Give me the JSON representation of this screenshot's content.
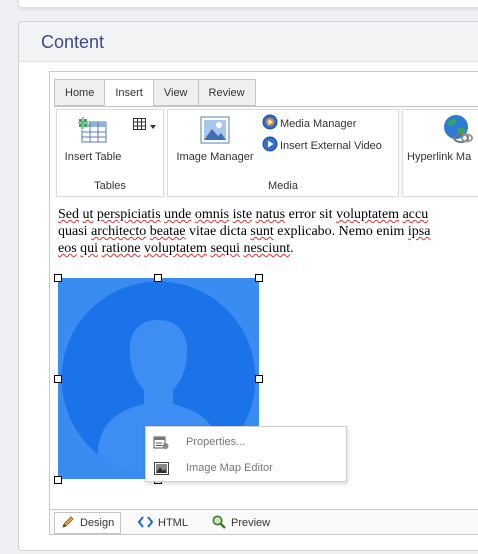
{
  "panel": {
    "title": "Content"
  },
  "tabs": [
    {
      "label": "Home",
      "active": false
    },
    {
      "label": "Insert",
      "active": true
    },
    {
      "label": "View",
      "active": false
    },
    {
      "label": "Review",
      "active": false
    }
  ],
  "ribbon": {
    "tables": {
      "group_label": "Tables",
      "insert_table_label": "Insert Table",
      "table_dropdown_icon": "table-grid-icon"
    },
    "media": {
      "group_label": "Media",
      "image_manager_label": "Image Manager",
      "media_manager_label": "Media Manager",
      "insert_video_label": "Insert External Video"
    },
    "links": {
      "hyperlink_label": "Hyperlink Ma"
    }
  },
  "content": {
    "line1": [
      "Sed",
      "ut",
      "perspiciatis",
      "unde",
      "omnis",
      "iste",
      "natus",
      "error sit",
      "voluptatem",
      "accu"
    ],
    "line2": [
      "quasi",
      "architecto",
      "beatae",
      "vitae dicta",
      "sunt",
      "explicabo. Nemo enim",
      "ipsa"
    ],
    "line3": [
      "eos",
      "qui",
      "ratione",
      "voluptatem",
      "sequi",
      "nesciunt",
      "."
    ],
    "image_alt": "user-avatar-placeholder"
  },
  "context_menu": {
    "items": [
      {
        "label": "Properties...",
        "icon": "properties-icon"
      },
      {
        "label": "Image Map Editor",
        "icon": "image-map-icon"
      }
    ]
  },
  "modes": [
    {
      "label": "Design",
      "icon": "pencil-icon",
      "active": true
    },
    {
      "label": "HTML",
      "icon": "code-brackets-icon",
      "active": false
    },
    {
      "label": "Preview",
      "icon": "magnifier-icon",
      "active": false
    }
  ],
  "colors": {
    "accent_title": "#3e4a85",
    "image_bg": "#3b8cf0",
    "avatar_circle": "#1a73e8"
  }
}
